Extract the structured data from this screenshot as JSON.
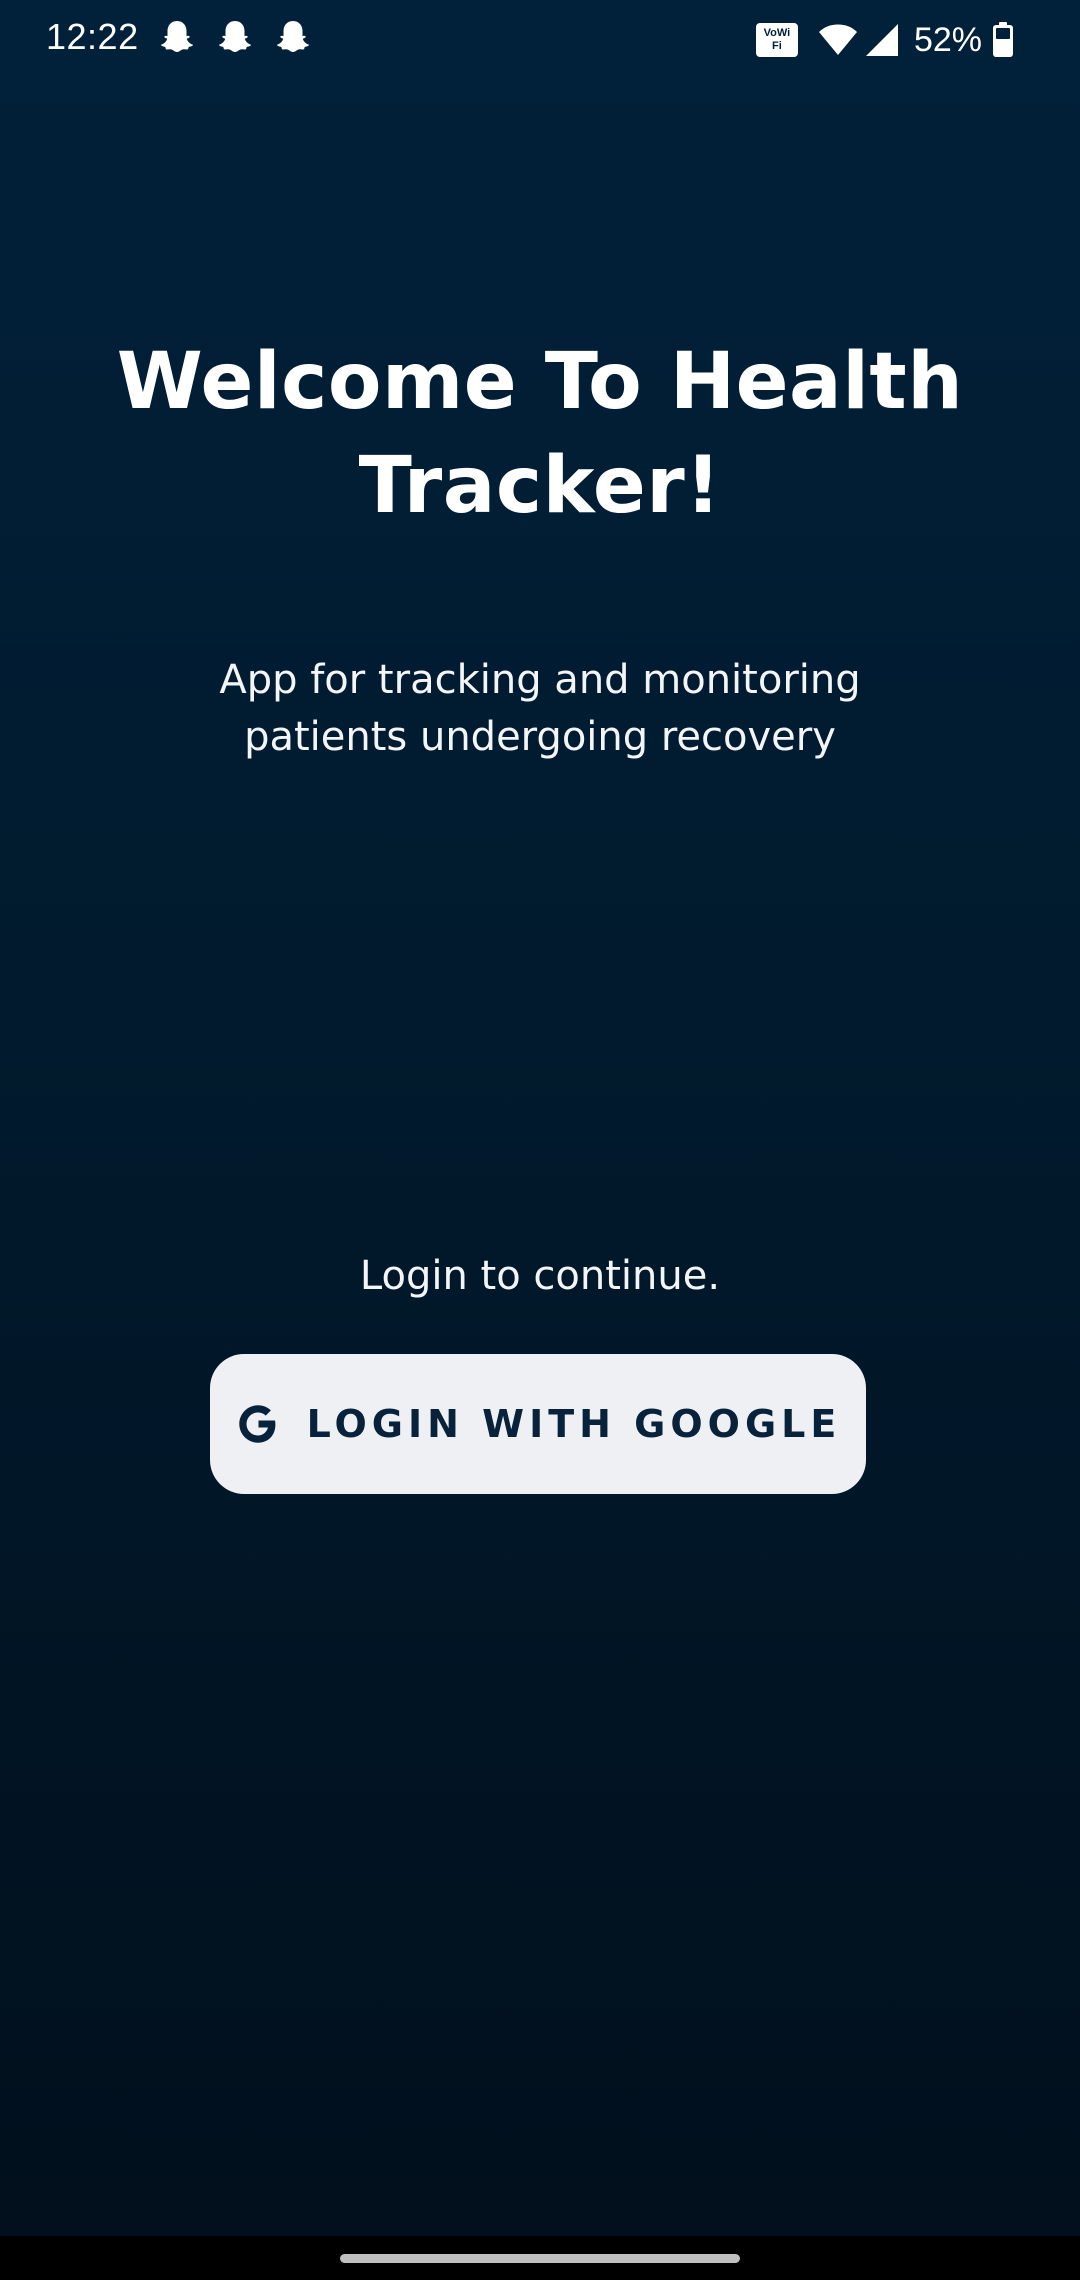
{
  "status_bar": {
    "time": "12:22",
    "notification_icons": [
      "snapchat-icon",
      "snapchat-icon",
      "snapchat-icon"
    ],
    "vowifi": "VoWiFi",
    "battery_percent": "52%"
  },
  "welcome": {
    "title": "Welcome To Health Tracker!",
    "subtitle": "App for tracking and monitoring patients undergoing recovery"
  },
  "login": {
    "prompt": "Login to continue.",
    "button_label": "LOGIN WITH GOOGLE",
    "button_icon": "google-icon"
  },
  "colors": {
    "background_top": "#01213a",
    "background_bottom": "#010f1b",
    "button_bg": "#eef0f3",
    "button_text": "#07223a"
  }
}
